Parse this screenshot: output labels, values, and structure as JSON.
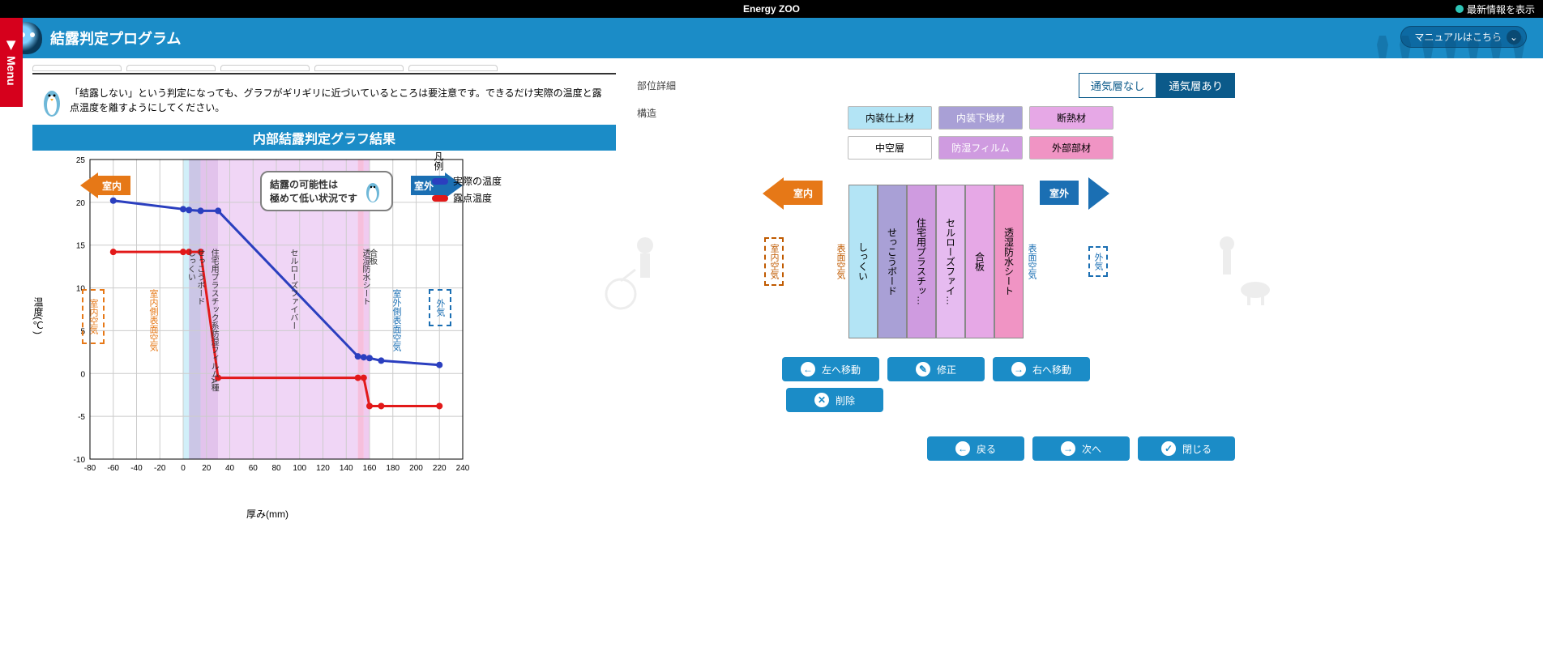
{
  "topbar": {
    "title": "Energy ZOO",
    "latest": "最新情報を表示"
  },
  "header": {
    "title": "結露判定プログラム",
    "manual_btn": "マニュアルはこちら"
  },
  "menu_tab": "Menu",
  "note": {
    "text": "「結露しない」という判定になっても、グラフがギリギリに近づいているところは要注意です。できるだけ実際の温度と露点温度を離すようにしてください。"
  },
  "chart": {
    "title": "内部結露判定グラフ結果",
    "ylabel": "温度(℃)",
    "xlabel": "厚み(mm)",
    "legend_title": "凡例",
    "legend": [
      {
        "label": "実際の温度",
        "color": "#2b3fbf"
      },
      {
        "label": "露点温度",
        "color": "#e21919"
      }
    ],
    "indoor": "室内",
    "outdoor": "室外",
    "callout": "結露の可能性は\n極めて低い状況です",
    "regions": {
      "indoor_air": "室内空気",
      "indoor_surface": "室内側表面空気",
      "outdoor_surface": "室外側表面空気",
      "outside_air": "外気"
    },
    "layer_labels": [
      "しっくい",
      "せっこうボード",
      "住宅用プラスチック系防湿フィルムA種",
      "セルローズファイバー",
      "透湿防水シート",
      "合板"
    ]
  },
  "chart_data": {
    "type": "line",
    "xlabel": "厚み(mm)",
    "ylabel": "温度(℃)",
    "xlim": [
      -80,
      240
    ],
    "ylim": [
      -10,
      25
    ],
    "xticks": [
      -80,
      -60,
      -40,
      -20,
      0,
      20,
      40,
      60,
      80,
      100,
      120,
      140,
      160,
      180,
      200,
      220,
      240
    ],
    "yticks": [
      -10,
      -5,
      0,
      5,
      10,
      15,
      20,
      25
    ],
    "x": [
      -60,
      0,
      5,
      15,
      30,
      150,
      155,
      160,
      170,
      220
    ],
    "series": [
      {
        "name": "実際の温度",
        "color": "#2b3fbf",
        "values": [
          20.2,
          19.2,
          19.1,
          19.0,
          19.0,
          2.0,
          1.9,
          1.8,
          1.5,
          1.0
        ]
      },
      {
        "name": "露点温度",
        "color": "#e21919",
        "values": [
          14.2,
          14.2,
          14.2,
          14.2,
          -0.5,
          -0.5,
          -0.5,
          -3.8,
          -3.8,
          -3.8
        ]
      }
    ],
    "bands": [
      {
        "from": 0,
        "to": 5,
        "color": "#b3e4f5"
      },
      {
        "from": 5,
        "to": 15,
        "color": "#a9a0d6"
      },
      {
        "from": 15,
        "to": 30,
        "color": "#cf9be0"
      },
      {
        "from": 30,
        "to": 150,
        "color": "#e6bbf0"
      },
      {
        "from": 150,
        "to": 155,
        "color": "#f094c4"
      },
      {
        "from": 155,
        "to": 160,
        "color": "#e6a8e6"
      }
    ]
  },
  "right": {
    "section_detail": "部位詳細",
    "structure_label": "構造",
    "toggle": {
      "no_vent": "通気層なし",
      "with_vent": "通気層あり"
    },
    "categories": [
      "内装仕上材",
      "内装下地材",
      "断熱材",
      "中空層",
      "防湿フィルム",
      "外部部材"
    ],
    "indoor": "室内",
    "outdoor": "室外",
    "indoor_air": "室内空気",
    "surface_air_in": "表面空気",
    "surface_air_out": "表面空気",
    "outside_air": "外気",
    "layers": [
      {
        "label": "しっくい",
        "color": "#b3e4f5",
        "w": 36
      },
      {
        "label": "せっこうボード",
        "color": "#a9a0d6",
        "w": 36
      },
      {
        "label": "住宅用プラスチッ…",
        "color": "#cf9be0",
        "w": 36
      },
      {
        "label": "セルローズファイ…",
        "color": "#e6bbf0",
        "w": 36
      },
      {
        "label": "合板",
        "color": "#e6a8e6",
        "w": 36
      },
      {
        "label": "透湿防水シート",
        "color": "#f094c4",
        "w": 36
      }
    ],
    "buttons": {
      "move_left": "左へ移動",
      "edit": "修正",
      "move_right": "右へ移動",
      "delete": "削除",
      "back": "戻る",
      "next": "次へ",
      "close": "閉じる"
    }
  }
}
